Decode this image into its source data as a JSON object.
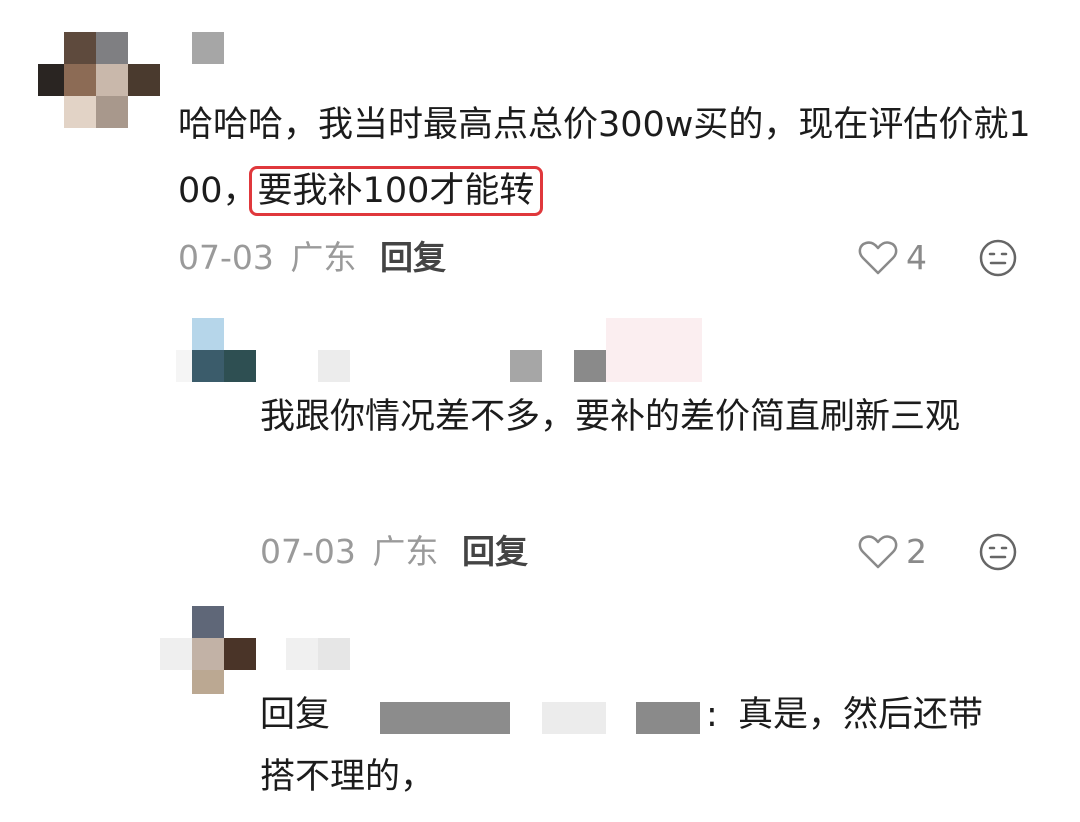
{
  "comment": {
    "text_before": "哈哈哈，我当时最高点总价300w买的，现在评估价就100，",
    "text_highlight": "要我补100才能转",
    "date": "07-03",
    "location": "广东",
    "reply_label": "回复",
    "likes": "4"
  },
  "reply1": {
    "text": "我跟你情况差不多，要补的差价简直刷新三观",
    "date": "07-03",
    "location": "广东",
    "reply_label": "回复",
    "likes": "2"
  },
  "reply2": {
    "prefix": "回复",
    "colon": ":",
    "text_line1": "真是，然后还带",
    "text_line2": "搭不理的，"
  },
  "colors": {
    "highlight_border": "#e0383c",
    "meta_gray": "#9a9a9a"
  },
  "icons": [
    "heart-icon",
    "emoji-icon"
  ]
}
